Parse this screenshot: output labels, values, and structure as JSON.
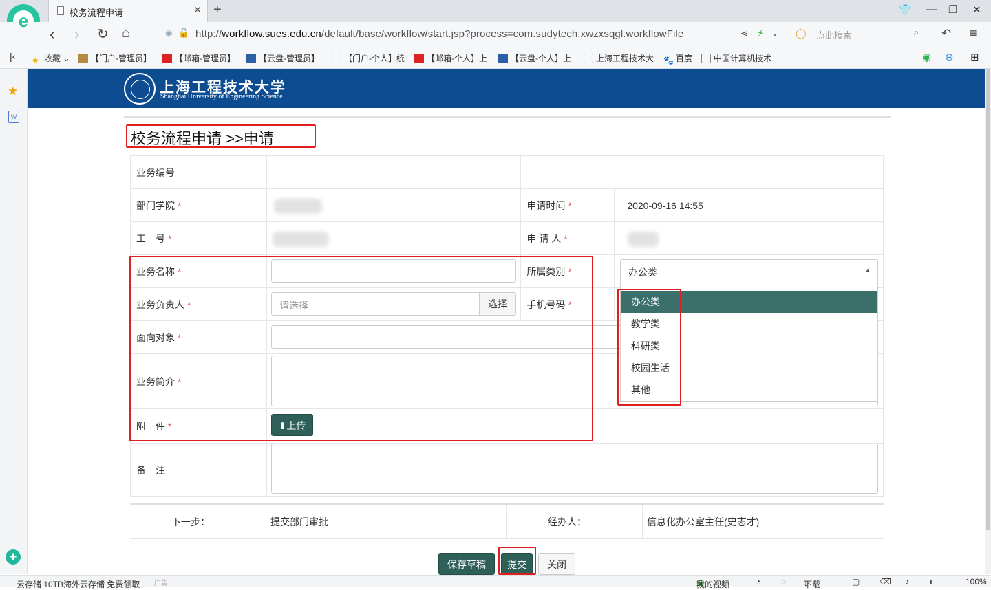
{
  "browser": {
    "tab_title": "校务流程申请",
    "url_prefix": "http://",
    "url_host": "workflow.sues.edu.cn",
    "url_path": "/default/base/workflow/start.jsp?process=com.sudytech.xwzxsqgl.workflowFile",
    "search_placeholder": "点此搜索",
    "logo_letter": "e"
  },
  "bookmarks": {
    "favorites": "收藏",
    "items": [
      "【门户-管理员】",
      "【邮箱-管理员】",
      "【云盘-管理员】",
      "【门户-个人】统",
      "【邮箱-个人】上",
      "【云盘-个人】上",
      "上海工程技术大",
      "百度",
      "中国计算机技术"
    ]
  },
  "header": {
    "university_cn": "上海工程技术大学",
    "university_en": "Shanghai University of Engineering Science"
  },
  "page": {
    "title": "校务流程申请 >>申请"
  },
  "form": {
    "required_mark": "*",
    "business_no_label": "业务编号",
    "department_label": "部门学院",
    "apply_time_label": "申请时间",
    "apply_time_value": "2020-09-16 14:55",
    "staff_no_label": "工　号",
    "applicant_label": "申 请 人",
    "business_name_label": "业务名称",
    "category_label": "所属类别",
    "category_value": "办公类",
    "owner_label": "业务负责人",
    "owner_placeholder": "请选择",
    "select_button": "选择",
    "phone_label": "手机号码",
    "audience_label": "面向对象",
    "intro_label": "业务简介",
    "attachment_label": "附　件",
    "upload_button": "上传",
    "remark_label": "备　注"
  },
  "category_options": [
    "办公类",
    "教学类",
    "科研类",
    "校园生活",
    "其他"
  ],
  "next_step": {
    "label": "下一步：",
    "value": "提交部门审批",
    "handler_label": "经办人：",
    "handler_value": "信息化办公室主任(史志才)"
  },
  "actions": {
    "save_draft": "保存草稿",
    "submit": "提交",
    "close": "关闭"
  },
  "statusbar": {
    "promo": "云存储 10TB海外云存储 免费领取",
    "ad": "广告",
    "video": "我的视频",
    "download": "下载",
    "zoom": "100%"
  },
  "colors": {
    "header_bg": "#0e4c92",
    "primary_button": "#2e5f59",
    "highlight": "#e02020",
    "selected_option": "#3a6f6a"
  }
}
